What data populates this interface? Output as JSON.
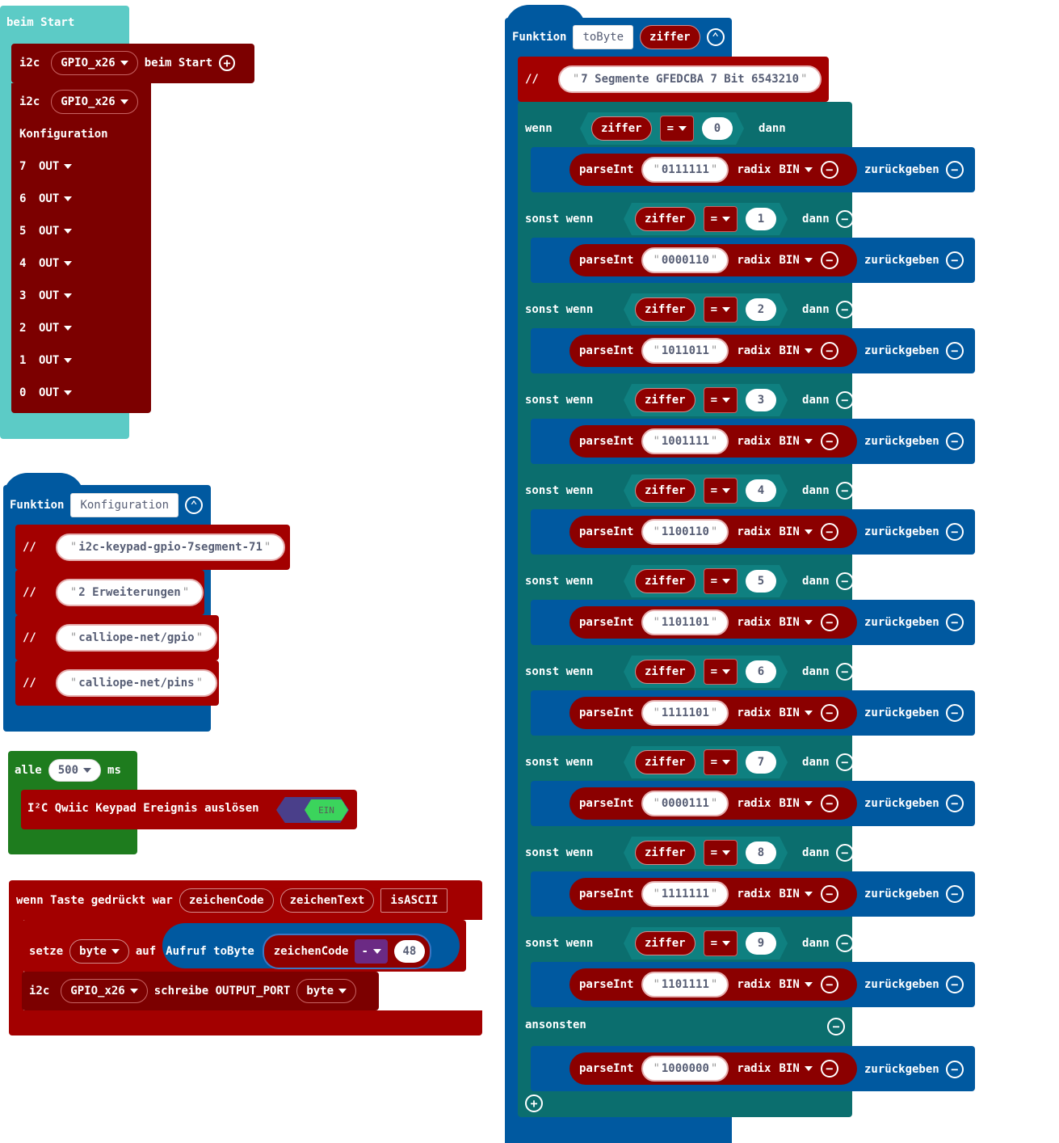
{
  "onstart": {
    "hat_label": "beim Start",
    "i2c1": {
      "label": "i2c",
      "device": "GPIO_x26",
      "suffix": "beim Start"
    },
    "i2c2": {
      "label": "i2c",
      "device": "GPIO_x26",
      "config_label": "Konfiguration"
    },
    "pins": [
      {
        "pin": "7",
        "mode": "OUT"
      },
      {
        "pin": "6",
        "mode": "OUT"
      },
      {
        "pin": "5",
        "mode": "OUT"
      },
      {
        "pin": "4",
        "mode": "OUT"
      },
      {
        "pin": "3",
        "mode": "OUT"
      },
      {
        "pin": "2",
        "mode": "OUT"
      },
      {
        "pin": "1",
        "mode": "OUT"
      },
      {
        "pin": "0",
        "mode": "OUT"
      }
    ]
  },
  "konfig": {
    "keyword": "Funktion",
    "name": "Konfiguration",
    "comment_marker": "//",
    "comments": [
      "i2c-keypad-gpio-7segment-71",
      "2 Erweiterungen",
      "calliope-net/gpio",
      "calliope-net/pins"
    ]
  },
  "every": {
    "label": "alle",
    "interval": "500",
    "unit": "ms",
    "keypad_label": "I²C Qwiic Keypad Ereignis auslösen",
    "toggle": "EIN"
  },
  "keyevent": {
    "label": "wenn Taste gedrückt war",
    "params": [
      "zeichenCode",
      "zeichenText",
      "isASCII"
    ],
    "set_label": "setze",
    "var": "byte",
    "to_label": "auf",
    "call_label": "Aufruf toByte",
    "arg": "zeichenCode",
    "op": "-",
    "operand": "48",
    "i2c_label": "i2c",
    "device": "GPIO_x26",
    "write_label": "schreibe OUTPUT_PORT",
    "write_var": "byte"
  },
  "tobyte": {
    "keyword": "Funktion",
    "name": "toByte",
    "param": "ziffer",
    "comment_marker": "//",
    "comment": "7 Segmente GFEDCBA 7 Bit 6543210",
    "if_label": "wenn",
    "elseif_label": "sonst wenn",
    "then_label": "dann",
    "else_label": "ansonsten",
    "var": "ziffer",
    "op": "=",
    "parse_label": "parseInt",
    "radix_label": "radix",
    "radix": "BIN",
    "return_label": "zurückgeben",
    "cases": [
      {
        "digit": "0",
        "bits": "0111111"
      },
      {
        "digit": "1",
        "bits": "0000110"
      },
      {
        "digit": "2",
        "bits": "1011011"
      },
      {
        "digit": "3",
        "bits": "1001111"
      },
      {
        "digit": "4",
        "bits": "1100110"
      },
      {
        "digit": "5",
        "bits": "1101101"
      },
      {
        "digit": "6",
        "bits": "1111101"
      },
      {
        "digit": "7",
        "bits": "0000111"
      },
      {
        "digit": "8",
        "bits": "1111111"
      },
      {
        "digit": "9",
        "bits": "1101111"
      }
    ],
    "else_bits": "1000000"
  },
  "colors": {
    "events": "#5ccbc6",
    "i2c": "#7c0000",
    "pins_red": "#a30000",
    "functions": "#0059a0",
    "logic": "#0b6e6e",
    "loops": "#1e7c1e",
    "math": "#6b2a84"
  }
}
